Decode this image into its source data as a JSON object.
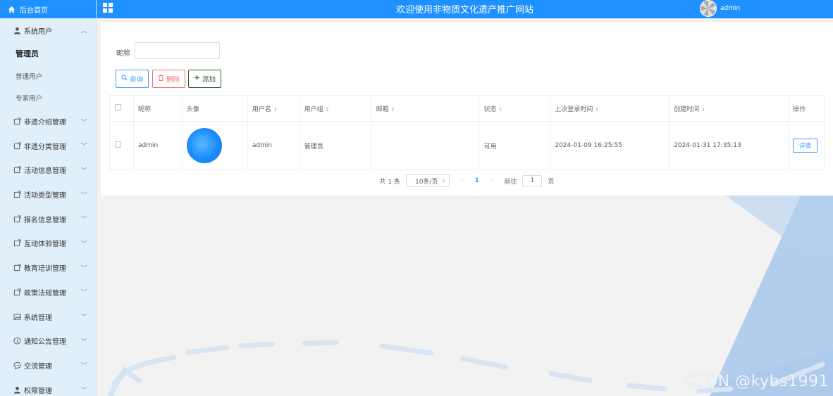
{
  "sidebar": {
    "home_label": "后台首页",
    "open_group": {
      "label": "系统用户",
      "children": [
        "管理员",
        "普通用户",
        "专家用户"
      ],
      "active_child": "管理员"
    },
    "groups": [
      {
        "label": "非遗介绍管理",
        "icon": "box-icon"
      },
      {
        "label": "非遗分类管理",
        "icon": "box-icon"
      },
      {
        "label": "活动信息管理",
        "icon": "box-icon"
      },
      {
        "label": "活动类型管理",
        "icon": "box-icon"
      },
      {
        "label": "报名信息管理",
        "icon": "box-icon"
      },
      {
        "label": "互动体验管理",
        "icon": "box-icon"
      },
      {
        "label": "教育培训管理",
        "icon": "box-icon"
      },
      {
        "label": "政策法规管理",
        "icon": "box-icon"
      },
      {
        "label": "系统管理",
        "icon": "image-icon"
      },
      {
        "label": "通知公告管理",
        "icon": "info-icon"
      },
      {
        "label": "交流管理",
        "icon": "chat-icon"
      },
      {
        "label": "权限管理",
        "icon": "user-icon"
      }
    ]
  },
  "header": {
    "title": "欢迎使用非物质文化遗产推广网站",
    "username": "admin"
  },
  "filters": {
    "nickname_label": "昵称",
    "nickname_value": ""
  },
  "toolbar": {
    "search_label": "查询",
    "delete_label": "删除",
    "add_label": "添加"
  },
  "table": {
    "columns": [
      "昵称",
      "头像",
      "用户名",
      "用户组",
      "邮箱",
      "状态",
      "上次登录时间",
      "创建时间",
      "操作"
    ],
    "rows": [
      {
        "nickname": "admin",
        "username": "admin",
        "group": "管理员",
        "email": "",
        "status": "可用",
        "last_login": "2024-01-09 16:25:55",
        "created": "2024-01-31 17:35:13",
        "action": "详情"
      }
    ]
  },
  "pager": {
    "total": "共 1 条",
    "page_size": "10条/页",
    "current_page": "1",
    "goto_label": "前往",
    "goto_value": "1",
    "page_suffix": "页"
  },
  "watermark": "CSDN @kybs1991",
  "colors": {
    "primary": "#1e90ff",
    "danger": "#f56c6c",
    "sidebar_bg": "#e1effa"
  }
}
